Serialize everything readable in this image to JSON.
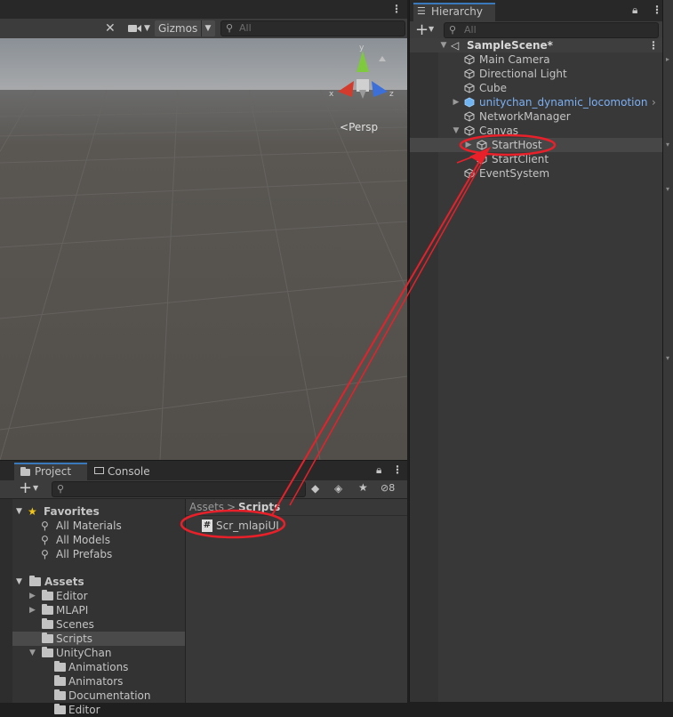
{
  "scene": {
    "gizmos_label": "Gizmos",
    "search_placeholder": "All",
    "persp_label": "Persp",
    "axis_x": "x",
    "axis_y": "y",
    "axis_z": "z"
  },
  "hierarchy": {
    "tab_label": "Hierarchy",
    "search_placeholder": "All",
    "scene_name": "SampleScene*",
    "items": [
      {
        "label": "Main Camera"
      },
      {
        "label": "Directional Light"
      },
      {
        "label": "Cube"
      },
      {
        "label": "unitychan_dynamic_locomotion"
      },
      {
        "label": "NetworkManager"
      },
      {
        "label": "Canvas"
      },
      {
        "label": "StartHost"
      },
      {
        "label": "StartClient"
      },
      {
        "label": "EventSystem"
      }
    ]
  },
  "project": {
    "tab_project": "Project",
    "tab_console": "Console",
    "hidden_count": "8",
    "favorites_label": "Favorites",
    "favorites": [
      {
        "label": "All Materials"
      },
      {
        "label": "All Models"
      },
      {
        "label": "All Prefabs"
      }
    ],
    "assets_label": "Assets",
    "folders": [
      {
        "label": "Editor"
      },
      {
        "label": "MLAPI"
      },
      {
        "label": "Scenes"
      },
      {
        "label": "Scripts"
      },
      {
        "label": "UnityChan"
      },
      {
        "label": "Animations"
      },
      {
        "label": "Animators"
      },
      {
        "label": "Documentation"
      },
      {
        "label": "Editor"
      }
    ],
    "breadcrumb_root": "Assets",
    "breadcrumb_sep": ">",
    "breadcrumb_current": "Scripts",
    "script_file": "Scr_mlapiUI"
  },
  "colors": {
    "annotation": "#e8202a",
    "accent": "#3a79bb",
    "prefab_text": "#7bb0f4"
  }
}
